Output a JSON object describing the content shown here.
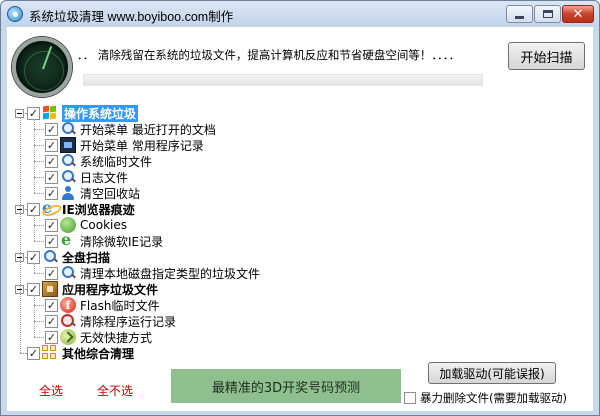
{
  "window": {
    "title": "系统垃圾清理  www.boyiboo.com制作"
  },
  "header": {
    "description": "．．   清除残留在系统的垃圾文件，提高计算机反应和节省硬盘空间等！．．．．",
    "progress_fraction": 0.0,
    "scan_button_label": "开始扫描"
  },
  "tree": {
    "groups": [
      {
        "label": "操作系统垃圾",
        "icon": "windows-logo-icon",
        "checked": true,
        "selected": true,
        "children": [
          {
            "label": "开始菜单  最近打开的文档",
            "icon": "search-icon",
            "checked": true
          },
          {
            "label": "开始菜单  常用程序记录",
            "icon": "start-menu-icon",
            "checked": true
          },
          {
            "label": "系统临时文件",
            "icon": "search-icon",
            "checked": true
          },
          {
            "label": "日志文件",
            "icon": "search-icon",
            "checked": true
          },
          {
            "label": "清空回收站",
            "icon": "user-icon",
            "checked": true
          }
        ]
      },
      {
        "label": "IE浏览器痕迹",
        "icon": "ie-icon",
        "checked": true,
        "selected": false,
        "children": [
          {
            "label": "Cookies",
            "icon": "cookie-icon",
            "checked": true
          },
          {
            "label": "清除微软IE记录",
            "icon": "ie-green-icon",
            "checked": true
          }
        ]
      },
      {
        "label": "全盘扫描",
        "icon": "search-icon",
        "checked": true,
        "selected": false,
        "children": [
          {
            "label": "清理本地磁盘指定类型的垃圾文件",
            "icon": "search-icon",
            "checked": true
          }
        ]
      },
      {
        "label": "应用程序垃圾文件",
        "icon": "apps-icon",
        "checked": true,
        "selected": false,
        "children": [
          {
            "label": "Flash临时文件",
            "icon": "flash-icon",
            "checked": true
          },
          {
            "label": "清除程序运行记录",
            "icon": "remove-icon",
            "checked": true
          },
          {
            "label": "无效快捷方式",
            "icon": "shortcut-icon",
            "checked": true
          }
        ]
      },
      {
        "label": "其他综合清理",
        "icon": "misc-icon",
        "checked": true,
        "selected": false,
        "children": []
      }
    ]
  },
  "footer": {
    "select_all_label": "全选",
    "select_none_label": "全不选",
    "ad_text": "最精准的3D开奖号码预测",
    "load_driver_label": "加载驱动(可能误报)",
    "force_delete_label": "暴力删除文件(需要加载驱动)",
    "force_delete_checked": false
  },
  "colors": {
    "link_red": "#c00000",
    "selection": "#3399ff",
    "ad_background": "#8fbf8f",
    "window_frame": "#c9d9ec"
  }
}
